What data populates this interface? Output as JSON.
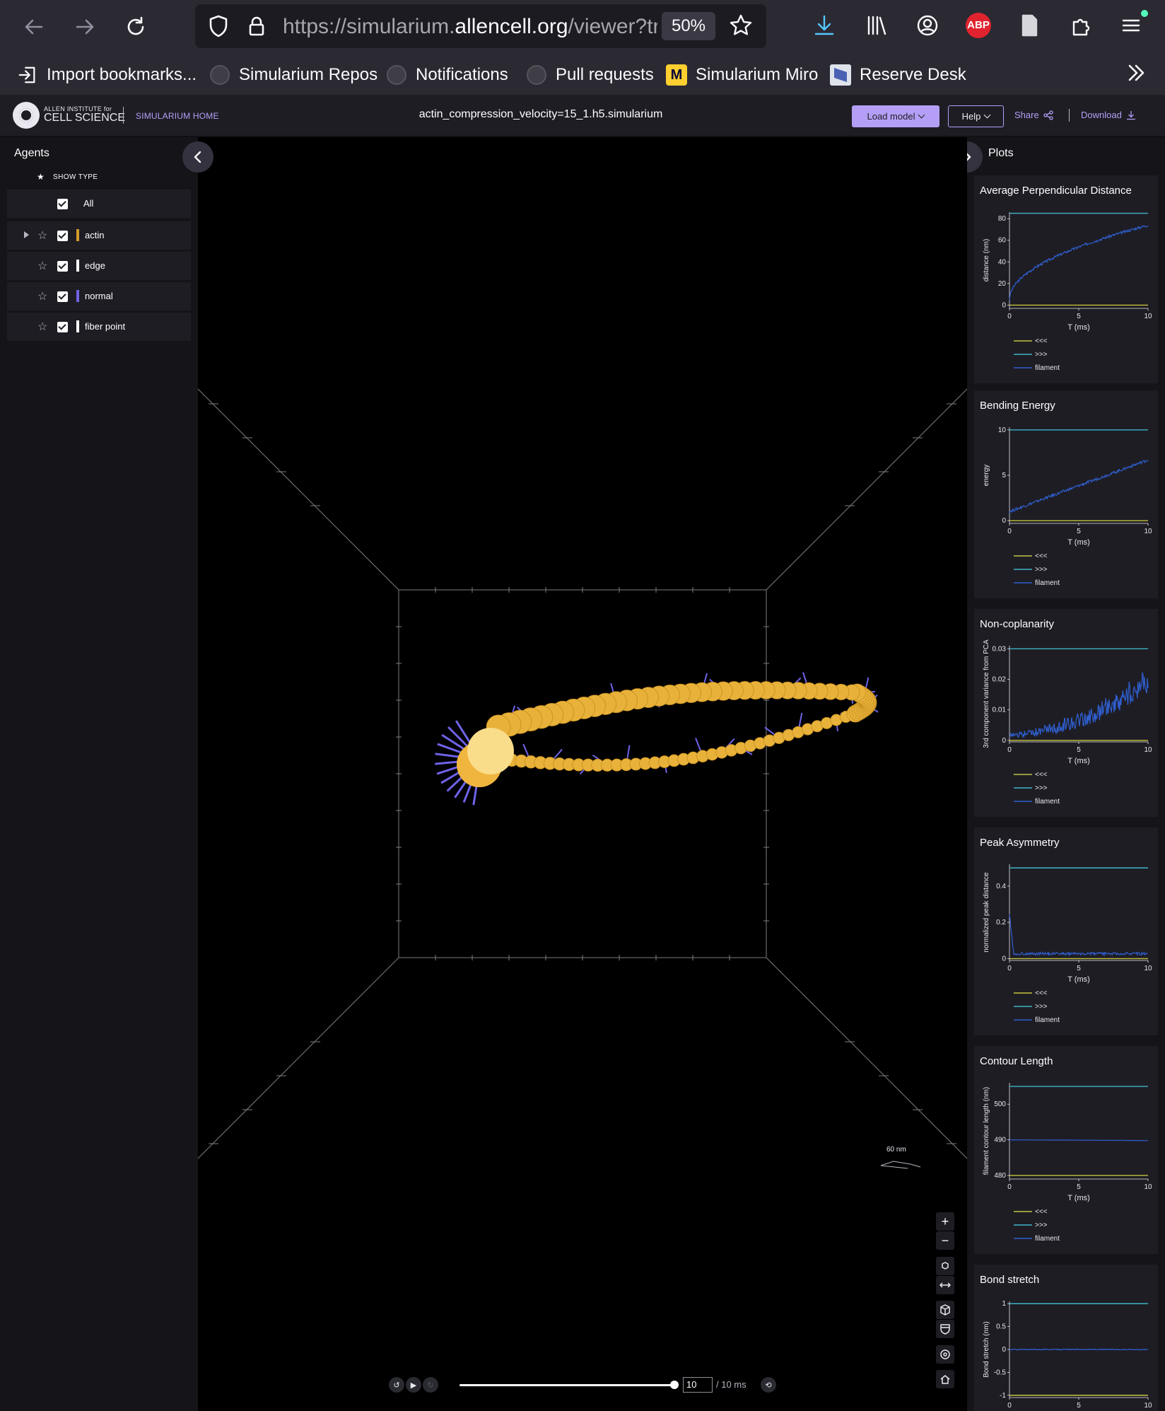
{
  "browser": {
    "url_prefix": "https://simularium.",
    "url_domain": "allencell.org",
    "url_suffix": "/viewer?tra",
    "zoom": "50%",
    "bookmarks": [
      {
        "label": "Import bookmarks...",
        "icon": "import-icon"
      },
      {
        "label": "Simularium Repos",
        "icon": "github-icon"
      },
      {
        "label": "Notifications",
        "icon": "github-icon"
      },
      {
        "label": "Pull requests",
        "icon": "github-icon"
      },
      {
        "label": "Simularium Miro",
        "icon": "miro-icon"
      },
      {
        "label": "Reserve Desk",
        "icon": "reserve-desk-icon"
      }
    ],
    "abp_label": "ABP"
  },
  "header": {
    "org_small": "ALLEN INSTITUTE for",
    "org_big": "CELL SCIENCE",
    "home_link": "SIMULARIUM HOME",
    "file_title": "actin_compression_velocity=15_1.h5.simularium",
    "load_model": "Load model",
    "help": "Help",
    "share": "Share",
    "download": "Download"
  },
  "agents": {
    "title": "Agents",
    "show_type_label": "SHOW TYPE",
    "all_label": "All",
    "items": [
      {
        "name": "actin",
        "color": "#d49a2a",
        "expandable": true
      },
      {
        "name": "edge",
        "color": "#ffffff",
        "expandable": false
      },
      {
        "name": "normal",
        "color": "#6f63e8",
        "expandable": false
      },
      {
        "name": "fiber point",
        "color": "#ffffff",
        "expandable": false
      }
    ]
  },
  "viewer": {
    "time_value": "10",
    "time_total": "/ 10 ms",
    "scale_label": "60 nm",
    "time_progress": 1.0
  },
  "plots": {
    "title": "Plots",
    "legend": [
      "<<<",
      ">>>",
      "filament"
    ],
    "colors": {
      "low": "#c4c341",
      "high": "#3fb3c6",
      "filament": "#2f5fd0"
    },
    "items": [
      {
        "title": "Average Perpendicular Distance",
        "ylabel": "distance (nm)",
        "xlabel": "T (ms)",
        "yticks": [
          "0",
          "20",
          "40",
          "60",
          "80"
        ],
        "xticks": [
          "0",
          "5",
          "10"
        ],
        "ymin": -3,
        "ymax": 86,
        "low": 0,
        "high": 85,
        "curve": "sqrt",
        "start": 5,
        "end": 74,
        "noise": 1.2
      },
      {
        "title": "Bending Energy",
        "ylabel": "energy",
        "xlabel": "T (ms)",
        "yticks": [
          "0",
          "5",
          "10"
        ],
        "xticks": [
          "0",
          "5",
          "10"
        ],
        "ymin": -0.3,
        "ymax": 10.3,
        "low": 0,
        "high": 10,
        "curve": "linear",
        "start": 1.0,
        "end": 6.7,
        "noise": 0.15
      },
      {
        "title": "Non-coplanarity",
        "ylabel": "3rd component variance from PCA",
        "xlabel": "T (ms)",
        "yticks": [
          "0",
          "0.01",
          "0.02",
          "0.03"
        ],
        "xticks": [
          "0",
          "5",
          "10"
        ],
        "ymin": -0.0005,
        "ymax": 0.031,
        "low": 0,
        "high": 0.03,
        "curve": "spiky",
        "start": 0.001,
        "end": 0.015,
        "noise": 0.004
      },
      {
        "title": "Peak Asymmetry",
        "ylabel": "normalized peak distance",
        "xlabel": "T (ms)",
        "yticks": [
          "0",
          "0.2",
          "0.4"
        ],
        "xticks": [
          "0",
          "5",
          "10"
        ],
        "ymin": -0.01,
        "ymax": 0.52,
        "low": 0,
        "high": 0.5,
        "curve": "decay",
        "start": 0.22,
        "end": 0.02,
        "noise": 0.015
      },
      {
        "title": "Contour Length",
        "ylabel": "filament contour length (nm)",
        "xlabel": "T (ms)",
        "yticks": [
          "480",
          "490",
          "500"
        ],
        "xticks": [
          "0",
          "5",
          "10"
        ],
        "ymin": 479,
        "ymax": 506,
        "low": 480,
        "high": 505,
        "curve": "flat",
        "start": 490,
        "end": 489.8,
        "noise": 0.03
      },
      {
        "title": "Bond stretch",
        "ylabel": "Bond stretch (nm)",
        "xlabel": "T (ms)",
        "yticks": [
          "-1",
          "-0.5",
          "0",
          "0.5",
          "1"
        ],
        "xticks": [
          "0",
          "5",
          "10"
        ],
        "ymin": -1.05,
        "ymax": 1.05,
        "low": -1,
        "high": 1,
        "curve": "flat",
        "start": 0,
        "end": 0,
        "noise": 0.01
      }
    ]
  }
}
